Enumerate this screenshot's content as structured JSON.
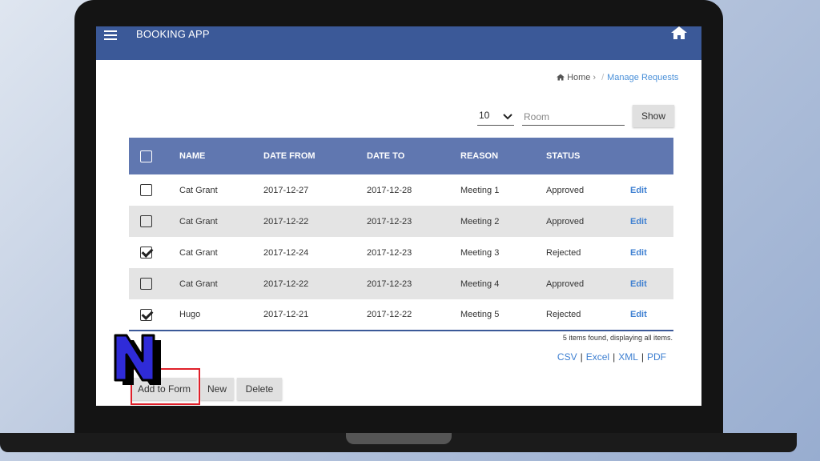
{
  "app": {
    "title": "BOOKING APP"
  },
  "breadcrumb": {
    "home": "Home",
    "current": "Manage Requests"
  },
  "controls": {
    "page_size": "10",
    "room_placeholder": "Room",
    "show_label": "Show"
  },
  "table": {
    "headers": [
      "NAME",
      "DATE FROM",
      "DATE TO",
      "REASON",
      "STATUS"
    ],
    "rows": [
      {
        "checked": false,
        "name": "Cat Grant",
        "date_from": "2017-12-27",
        "date_to": "2017-12-28",
        "reason": "Meeting 1",
        "status": "Approved",
        "action": "Edit"
      },
      {
        "checked": false,
        "name": "Cat Grant",
        "date_from": "2017-12-22",
        "date_to": "2017-12-23",
        "reason": "Meeting 2",
        "status": "Approved",
        "action": "Edit"
      },
      {
        "checked": true,
        "name": "Cat Grant",
        "date_from": "2017-12-24",
        "date_to": "2017-12-23",
        "reason": "Meeting 3",
        "status": "Rejected",
        "action": "Edit"
      },
      {
        "checked": false,
        "name": "Cat Grant",
        "date_from": "2017-12-22",
        "date_to": "2017-12-23",
        "reason": "Meeting 4",
        "status": "Approved",
        "action": "Edit"
      },
      {
        "checked": true,
        "name": "Hugo",
        "date_from": "2017-12-21",
        "date_to": "2017-12-22",
        "reason": "Meeting 5",
        "status": "Rejected",
        "action": "Edit"
      }
    ],
    "summary": "5 items found, displaying all items."
  },
  "exports": [
    "CSV",
    "Excel",
    "XML",
    "PDF"
  ],
  "actions": {
    "add_to_form": "Add to Form",
    "new": "New",
    "delete": "Delete"
  },
  "logo": {
    "letter": "N"
  },
  "colors": {
    "header": "#3b5998",
    "table_header": "#6077b0",
    "link": "#3d7fd1",
    "highlight": "#e0202a",
    "logo_fill": "#2f2bd8"
  }
}
